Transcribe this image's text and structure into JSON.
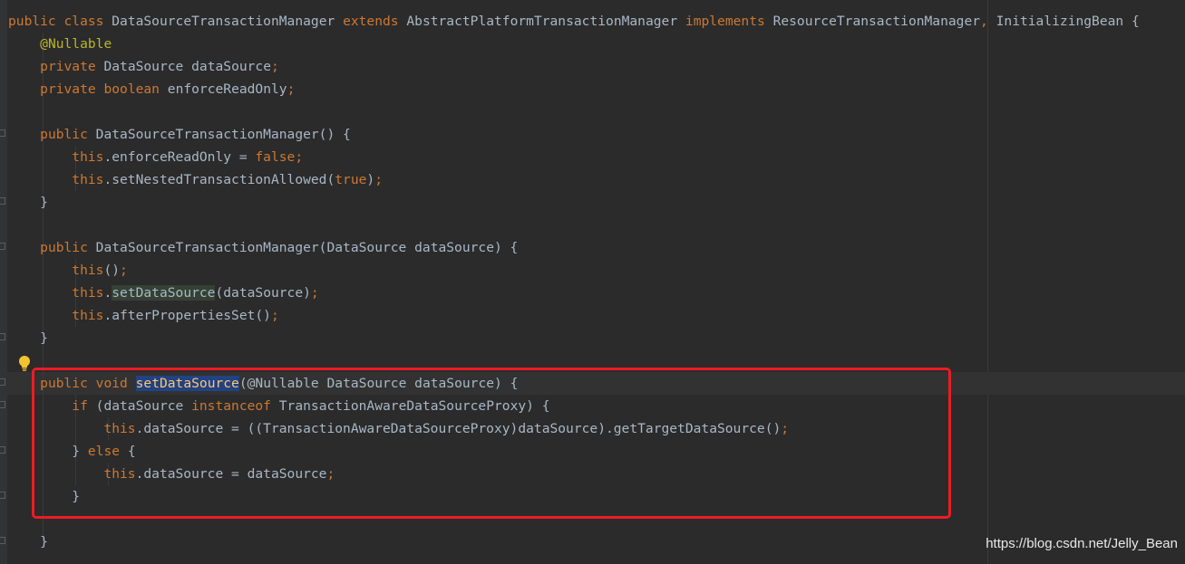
{
  "editor": {
    "theme": "darcula",
    "colors": {
      "background": "#2b2b2b",
      "keyword": "#cc7832",
      "annotation": "#bbb529",
      "text": "#a9b7c6",
      "highlight_box": "#ec1c24",
      "selection": "#214283"
    }
  },
  "code": {
    "l1": {
      "public": "public",
      "class": "class",
      "name": "DataSourceTransactionManager",
      "extends": "extends",
      "parent": "AbstractPlatformTransactionManager",
      "implements": "implements",
      "iface1": "ResourceTransactionManager",
      "comma": ",",
      "iface2": "InitializingBean",
      "brace": "{"
    },
    "l2": {
      "annotation": "@Nullable"
    },
    "l3": {
      "private": "private",
      "type": "DataSource",
      "name": "dataSource",
      "semi": ";"
    },
    "l4": {
      "private": "private",
      "type": "boolean",
      "name": "enforceReadOnly",
      "semi": ";"
    },
    "l6": {
      "public": "public",
      "rest": "DataSourceTransactionManager() {"
    },
    "l7": {
      "this": "this",
      "mid": ".enforceReadOnly = ",
      "value": "false",
      "semi": ";"
    },
    "l8": {
      "this": "this",
      "mid": ".setNestedTransactionAllowed(",
      "value": "true",
      "end": ")",
      "semi": ";"
    },
    "l9": {
      "text": "}"
    },
    "l11": {
      "public": "public",
      "rest": "DataSourceTransactionManager(DataSource dataSource) {"
    },
    "l12": {
      "this": "this",
      "end": "()",
      "semi": ";"
    },
    "l13": {
      "this": "this",
      "dot": ".",
      "call": "setDataSource",
      "end": "(dataSource)",
      "semi": ";"
    },
    "l14": {
      "this": "this",
      "end": ".afterPropertiesSet()",
      "semi": ";"
    },
    "l15": {
      "text": "}"
    },
    "l17": {
      "public": "public",
      "void": "void",
      "method": "setDataSource",
      "rest": "(@Nullable DataSource dataSource) {"
    },
    "l18": {
      "if": "if",
      "mid": " (dataSource ",
      "instanceof": "instanceof",
      "rest": " TransactionAwareDataSourceProxy) {"
    },
    "l19": {
      "this": "this",
      "rest": ".dataSource = ((TransactionAwareDataSourceProxy)dataSource).getTargetDataSource()",
      "semi": ";"
    },
    "l20": {
      "close": "} ",
      "else": "else",
      "brace": " {"
    },
    "l21": {
      "this": "this",
      "rest": ".dataSource = dataSource",
      "semi": ";"
    },
    "l22": {
      "text": "}"
    },
    "l24": {
      "text": "}"
    }
  },
  "gutter": {
    "intention_icon": "lightbulb-icon"
  },
  "watermark": {
    "text": "https://blog.csdn.net/Jelly_Bean"
  }
}
